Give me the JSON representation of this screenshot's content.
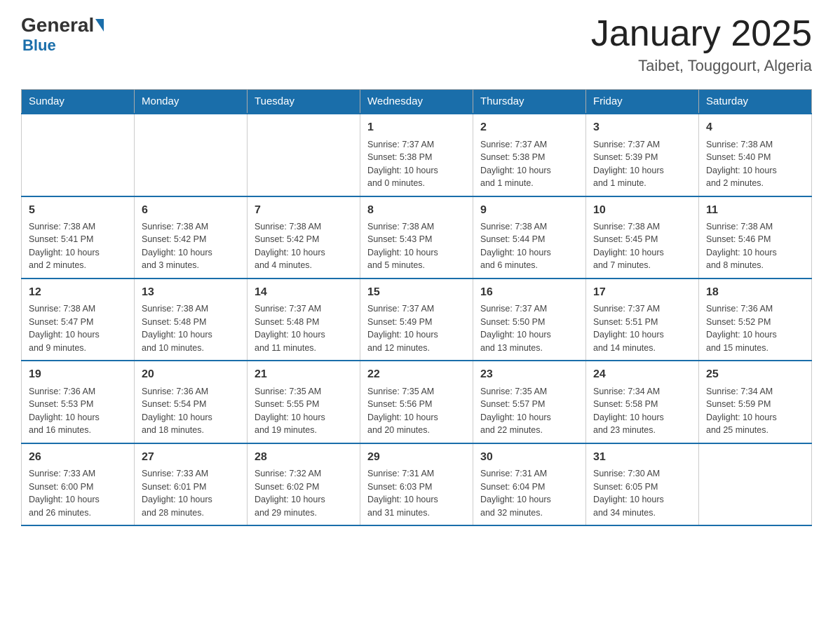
{
  "header": {
    "logo": {
      "general": "General",
      "blue": "Blue"
    },
    "title": "January 2025",
    "location": "Taibet, Touggourt, Algeria"
  },
  "days_of_week": [
    "Sunday",
    "Monday",
    "Tuesday",
    "Wednesday",
    "Thursday",
    "Friday",
    "Saturday"
  ],
  "weeks": [
    [
      {
        "day": "",
        "info": ""
      },
      {
        "day": "",
        "info": ""
      },
      {
        "day": "",
        "info": ""
      },
      {
        "day": "1",
        "info": "Sunrise: 7:37 AM\nSunset: 5:38 PM\nDaylight: 10 hours\nand 0 minutes."
      },
      {
        "day": "2",
        "info": "Sunrise: 7:37 AM\nSunset: 5:38 PM\nDaylight: 10 hours\nand 1 minute."
      },
      {
        "day": "3",
        "info": "Sunrise: 7:37 AM\nSunset: 5:39 PM\nDaylight: 10 hours\nand 1 minute."
      },
      {
        "day": "4",
        "info": "Sunrise: 7:38 AM\nSunset: 5:40 PM\nDaylight: 10 hours\nand 2 minutes."
      }
    ],
    [
      {
        "day": "5",
        "info": "Sunrise: 7:38 AM\nSunset: 5:41 PM\nDaylight: 10 hours\nand 2 minutes."
      },
      {
        "day": "6",
        "info": "Sunrise: 7:38 AM\nSunset: 5:42 PM\nDaylight: 10 hours\nand 3 minutes."
      },
      {
        "day": "7",
        "info": "Sunrise: 7:38 AM\nSunset: 5:42 PM\nDaylight: 10 hours\nand 4 minutes."
      },
      {
        "day": "8",
        "info": "Sunrise: 7:38 AM\nSunset: 5:43 PM\nDaylight: 10 hours\nand 5 minutes."
      },
      {
        "day": "9",
        "info": "Sunrise: 7:38 AM\nSunset: 5:44 PM\nDaylight: 10 hours\nand 6 minutes."
      },
      {
        "day": "10",
        "info": "Sunrise: 7:38 AM\nSunset: 5:45 PM\nDaylight: 10 hours\nand 7 minutes."
      },
      {
        "day": "11",
        "info": "Sunrise: 7:38 AM\nSunset: 5:46 PM\nDaylight: 10 hours\nand 8 minutes."
      }
    ],
    [
      {
        "day": "12",
        "info": "Sunrise: 7:38 AM\nSunset: 5:47 PM\nDaylight: 10 hours\nand 9 minutes."
      },
      {
        "day": "13",
        "info": "Sunrise: 7:38 AM\nSunset: 5:48 PM\nDaylight: 10 hours\nand 10 minutes."
      },
      {
        "day": "14",
        "info": "Sunrise: 7:37 AM\nSunset: 5:48 PM\nDaylight: 10 hours\nand 11 minutes."
      },
      {
        "day": "15",
        "info": "Sunrise: 7:37 AM\nSunset: 5:49 PM\nDaylight: 10 hours\nand 12 minutes."
      },
      {
        "day": "16",
        "info": "Sunrise: 7:37 AM\nSunset: 5:50 PM\nDaylight: 10 hours\nand 13 minutes."
      },
      {
        "day": "17",
        "info": "Sunrise: 7:37 AM\nSunset: 5:51 PM\nDaylight: 10 hours\nand 14 minutes."
      },
      {
        "day": "18",
        "info": "Sunrise: 7:36 AM\nSunset: 5:52 PM\nDaylight: 10 hours\nand 15 minutes."
      }
    ],
    [
      {
        "day": "19",
        "info": "Sunrise: 7:36 AM\nSunset: 5:53 PM\nDaylight: 10 hours\nand 16 minutes."
      },
      {
        "day": "20",
        "info": "Sunrise: 7:36 AM\nSunset: 5:54 PM\nDaylight: 10 hours\nand 18 minutes."
      },
      {
        "day": "21",
        "info": "Sunrise: 7:35 AM\nSunset: 5:55 PM\nDaylight: 10 hours\nand 19 minutes."
      },
      {
        "day": "22",
        "info": "Sunrise: 7:35 AM\nSunset: 5:56 PM\nDaylight: 10 hours\nand 20 minutes."
      },
      {
        "day": "23",
        "info": "Sunrise: 7:35 AM\nSunset: 5:57 PM\nDaylight: 10 hours\nand 22 minutes."
      },
      {
        "day": "24",
        "info": "Sunrise: 7:34 AM\nSunset: 5:58 PM\nDaylight: 10 hours\nand 23 minutes."
      },
      {
        "day": "25",
        "info": "Sunrise: 7:34 AM\nSunset: 5:59 PM\nDaylight: 10 hours\nand 25 minutes."
      }
    ],
    [
      {
        "day": "26",
        "info": "Sunrise: 7:33 AM\nSunset: 6:00 PM\nDaylight: 10 hours\nand 26 minutes."
      },
      {
        "day": "27",
        "info": "Sunrise: 7:33 AM\nSunset: 6:01 PM\nDaylight: 10 hours\nand 28 minutes."
      },
      {
        "day": "28",
        "info": "Sunrise: 7:32 AM\nSunset: 6:02 PM\nDaylight: 10 hours\nand 29 minutes."
      },
      {
        "day": "29",
        "info": "Sunrise: 7:31 AM\nSunset: 6:03 PM\nDaylight: 10 hours\nand 31 minutes."
      },
      {
        "day": "30",
        "info": "Sunrise: 7:31 AM\nSunset: 6:04 PM\nDaylight: 10 hours\nand 32 minutes."
      },
      {
        "day": "31",
        "info": "Sunrise: 7:30 AM\nSunset: 6:05 PM\nDaylight: 10 hours\nand 34 minutes."
      },
      {
        "day": "",
        "info": ""
      }
    ]
  ]
}
